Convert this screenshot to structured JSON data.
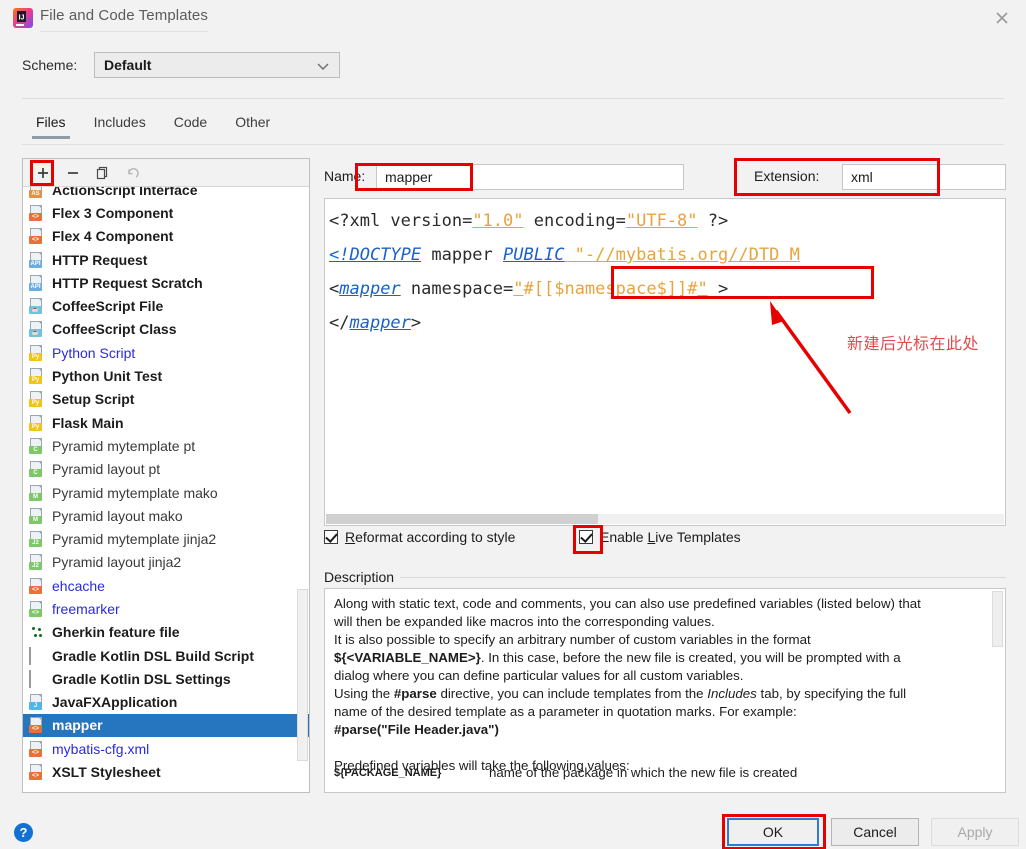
{
  "window": {
    "title": "File and Code Templates",
    "logo_icon": "intellij-idea-logo",
    "close_icon": "close-icon"
  },
  "scheme": {
    "label": "Scheme:",
    "value": "Default",
    "chevron_icon": "chevron-down-icon"
  },
  "tabs": [
    {
      "label": "Files",
      "active": true
    },
    {
      "label": "Includes",
      "active": false
    },
    {
      "label": "Code",
      "active": false
    },
    {
      "label": "Other",
      "active": false
    }
  ],
  "list_toolbar": [
    {
      "name": "add-template-button",
      "glyph": "+",
      "disabled": false
    },
    {
      "name": "remove-template-button",
      "glyph": "−",
      "disabled": false
    },
    {
      "name": "copy-template-button",
      "glyph": "copy-icon",
      "disabled": false
    },
    {
      "name": "reset-template-button",
      "glyph": "undo-icon",
      "disabled": true
    }
  ],
  "template_list": [
    {
      "label": "ActionScript Interface",
      "badge": "AS",
      "badge_color": "#e8913a",
      "text_color": "#1c1c1c",
      "icon": "file-template-icon",
      "selected": false,
      "clipped": true
    },
    {
      "label": "Flex 3 Component",
      "badge": "<>",
      "badge_color": "#e8703a",
      "text_color": "#1c1c1c",
      "icon": "file-template-icon",
      "selected": false
    },
    {
      "label": "Flex 4 Component",
      "badge": "<>",
      "badge_color": "#e8703a",
      "text_color": "#1c1c1c",
      "icon": "file-template-icon",
      "selected": false
    },
    {
      "label": "HTTP Request",
      "badge": "API",
      "badge_color": "#6aaede",
      "text_color": "#1c1c1c",
      "icon": "file-template-icon",
      "selected": false
    },
    {
      "label": "HTTP Request Scratch",
      "badge": "API",
      "badge_color": "#6aaede",
      "text_color": "#1c1c1c",
      "icon": "file-template-icon",
      "selected": false
    },
    {
      "label": "CoffeeScript File",
      "badge": "☕",
      "badge_color": "#6fc3e0",
      "text_color": "#1c1c1c",
      "icon": "coffeescript-icon",
      "selected": false
    },
    {
      "label": "CoffeeScript Class",
      "badge": "☕",
      "badge_color": "#6fc3e0",
      "text_color": "#1c1c1c",
      "icon": "coffeescript-icon",
      "selected": false
    },
    {
      "label": "Python Script",
      "badge": "Py",
      "badge_color": "#f0c419",
      "text_color": "#2a2ae0",
      "icon": "python-icon",
      "selected": false
    },
    {
      "label": "Python Unit Test",
      "badge": "Py",
      "badge_color": "#f0c419",
      "text_color": "#1c1c1c",
      "icon": "python-icon",
      "selected": false
    },
    {
      "label": "Setup Script",
      "badge": "Py",
      "badge_color": "#f0c419",
      "text_color": "#1c1c1c",
      "icon": "python-icon",
      "selected": false
    },
    {
      "label": "Flask Main",
      "badge": "Py",
      "badge_color": "#f0c419",
      "text_color": "#1c1c1c",
      "icon": "python-icon",
      "selected": false
    },
    {
      "label": "Pyramid mytemplate pt",
      "badge": "C",
      "badge_color": "#7ec86a",
      "text_color": "#3a3a3a",
      "icon": "pyramid-icon",
      "selected": false
    },
    {
      "label": "Pyramid layout pt",
      "badge": "C",
      "badge_color": "#7ec86a",
      "text_color": "#3a3a3a",
      "icon": "pyramid-icon",
      "selected": false
    },
    {
      "label": "Pyramid mytemplate mako",
      "badge": "M",
      "badge_color": "#7ec86a",
      "text_color": "#3a3a3a",
      "icon": "pyramid-icon",
      "selected": false
    },
    {
      "label": "Pyramid layout mako",
      "badge": "M",
      "badge_color": "#7ec86a",
      "text_color": "#3a3a3a",
      "icon": "pyramid-icon",
      "selected": false
    },
    {
      "label": "Pyramid mytemplate jinja2",
      "badge": "J2",
      "badge_color": "#7ec86a",
      "text_color": "#3a3a3a",
      "icon": "pyramid-icon",
      "selected": false
    },
    {
      "label": "Pyramid layout jinja2",
      "badge": "J2",
      "badge_color": "#7ec86a",
      "text_color": "#3a3a3a",
      "icon": "pyramid-icon",
      "selected": false
    },
    {
      "label": "ehcache",
      "badge": "<>",
      "badge_color": "#e8703a",
      "text_color": "#2a2ae0",
      "icon": "xml-template-icon",
      "selected": false
    },
    {
      "label": "freemarker",
      "badge": "<>",
      "badge_color": "#7ec86a",
      "text_color": "#2a2ae0",
      "icon": "freemarker-icon",
      "selected": false
    },
    {
      "label": "Gherkin feature file",
      "badge": "",
      "badge_color": "",
      "text_color": "#1c1c1c",
      "icon": "gherkin-icon",
      "selected": false
    },
    {
      "label": "Gradle Kotlin DSL Build Script",
      "badge": "",
      "badge_color": "",
      "text_color": "#1c1c1c",
      "icon": "gradle-icon",
      "selected": false
    },
    {
      "label": "Gradle Kotlin DSL Settings",
      "badge": "",
      "badge_color": "",
      "text_color": "#1c1c1c",
      "icon": "gradle-icon",
      "selected": false
    },
    {
      "label": "JavaFXApplication",
      "badge": "J",
      "badge_color": "#4fb8e8",
      "text_color": "#1c1c1c",
      "icon": "javafx-icon",
      "selected": false
    },
    {
      "label": "mapper",
      "badge": "<>",
      "badge_color": "#e8703a",
      "text_color": "#ffffff",
      "icon": "xml-template-icon",
      "selected": true
    },
    {
      "label": "mybatis-cfg.xml",
      "badge": "<>",
      "badge_color": "#e8703a",
      "text_color": "#2a2ae0",
      "icon": "xml-template-icon",
      "selected": false
    },
    {
      "label": "XSLT Stylesheet",
      "badge": "<>",
      "badge_color": "#e8703a",
      "text_color": "#1c1c1c",
      "icon": "xml-template-icon",
      "selected": false
    }
  ],
  "form": {
    "name_label": "Name:",
    "name_value": "mapper",
    "extension_label": "Extension:",
    "extension_value": "xml"
  },
  "editor": {
    "lines": [
      {
        "tokens": [
          {
            "t": "<?xml ",
            "c": "plain"
          },
          {
            "t": "version=",
            "c": "plain"
          },
          {
            "t": "\"1.0\"",
            "c": "str"
          },
          {
            "t": " encoding=",
            "c": "plain"
          },
          {
            "t": "\"UTF-8\"",
            "c": "str"
          },
          {
            "t": " ?>",
            "c": "plain"
          }
        ]
      },
      {
        "tokens": [
          {
            "t": "<!DOCTYPE",
            "c": "tag"
          },
          {
            "t": " mapper ",
            "c": "plain"
          },
          {
            "t": "PUBLIC",
            "c": "tag"
          },
          {
            "t": " \"-//mybatis.org//DTD M",
            "c": "str"
          }
        ]
      },
      {
        "tokens": [
          {
            "t": "<",
            "c": "plain"
          },
          {
            "t": "mapper",
            "c": "tag"
          },
          {
            "t": " namespace=",
            "c": "plain"
          },
          {
            "t": "\"",
            "c": "str"
          },
          {
            "t": "#[[$namespace$]]#",
            "c": "var"
          },
          {
            "t": "\"",
            "c": "str"
          },
          {
            "t": " >",
            "c": "plain"
          }
        ]
      },
      {
        "tokens": [
          {
            "t": "</",
            "c": "plain"
          },
          {
            "t": "mapper",
            "c": "tag"
          },
          {
            "t": ">",
            "c": "plain"
          }
        ]
      }
    ]
  },
  "options": {
    "reformat": {
      "label_pre": "R",
      "label_rest": "eformat according to style",
      "checked": true
    },
    "live_templates": {
      "label_pre": "Enable ",
      "mnemonic": "L",
      "label_rest": "ive Templates",
      "checked": true
    }
  },
  "description": {
    "group_title": "Description",
    "paragraphs": [
      "Along with static text, code and comments, you can also use predefined variables (listed below) that will then be expanded like macros into the corresponding values.",
      "It is also possible to specify an arbitrary number of custom variables in the format ${<VARIABLE_NAME>}. In this case, before the new file is created, you will be prompted with a dialog where you can define particular values for all custom variables.",
      "Using the #parse directive, you can include templates from the Includes tab, by specifying the full name of the desired template as a parameter in quotation marks. For example:",
      "#parse(\"File Header.java\")",
      "Predefined variables will take the following values:"
    ],
    "line1a": "Along with static text, code and comments, you can also use predefined variables (listed below) that",
    "line1b": "will then be expanded like macros into the corresponding values.",
    "line2a": "It is also possible to specify an arbitrary number of custom variables in the format",
    "line2b_bold": "${<VARIABLE_NAME>}",
    "line2b_rest": ". In this case, before the new file is created, you will be prompted with a",
    "line2c": "dialog where you can define particular values for all custom variables.",
    "line3a": "Using the ",
    "line3_parse": "#parse",
    "line3b": " directive, you can include templates from the ",
    "line3_includes": "Includes",
    "line3c": " tab, by specifying the full",
    "line3d": "name of the desired template as a parameter in quotation marks. For example:",
    "line4": "#parse(\"File Header.java\")",
    "line5": "Predefined variables will take the following values:",
    "var_name": "${PACKAGE_NAME}",
    "var_desc": "name of the package in which the new file is created"
  },
  "footer": {
    "help_glyph": "?",
    "ok": "OK",
    "cancel": "Cancel",
    "apply": "Apply"
  },
  "annotations": {
    "note_text": "新建后光标在此处",
    "highlight_color": "#e60000",
    "note_color": "#e24b4b"
  }
}
